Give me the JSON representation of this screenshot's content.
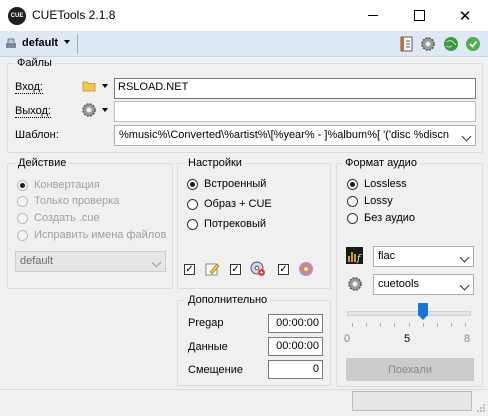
{
  "window": {
    "title": "CUETools 2.1.8",
    "app_icon_text": "CUE"
  },
  "toolbar": {
    "profile": "default"
  },
  "files": {
    "title": "Файлы",
    "input_label": "Вход:",
    "input_value": "RSLOAD.NET",
    "output_label": "Выход:",
    "output_value": "",
    "template_label": "Шаблон:",
    "template_value": "%music%\\Converted\\%artist%\\[%year% - ]%album%[ '('disc %discn"
  },
  "action": {
    "title": "Действие",
    "options": [
      "Конвертация",
      "Только проверка",
      "Создать .cue",
      "Исправить имена файлов"
    ],
    "selected": 0,
    "profile_combo": "default"
  },
  "settings": {
    "title": "Настройки",
    "options": [
      "Встроенный",
      "Образ + CUE",
      "Потрековый"
    ],
    "selected": 0
  },
  "extra": {
    "title": "Дополнительно",
    "pregap_label": "Pregap",
    "pregap_value": "00:00:00",
    "data_label": "Данные",
    "data_value": "00:00:00",
    "offset_label": "Смещение",
    "offset_value": "0"
  },
  "audio": {
    "title": "Формат аудио",
    "options": [
      "Lossless",
      "Lossy",
      "Без аудио"
    ],
    "selected": 0,
    "codec": "flac",
    "encoder": "cuetools",
    "slider_min": "0",
    "slider_mid": "5",
    "slider_max": "8",
    "compression_level": 5,
    "go_label": "Поехали"
  }
}
